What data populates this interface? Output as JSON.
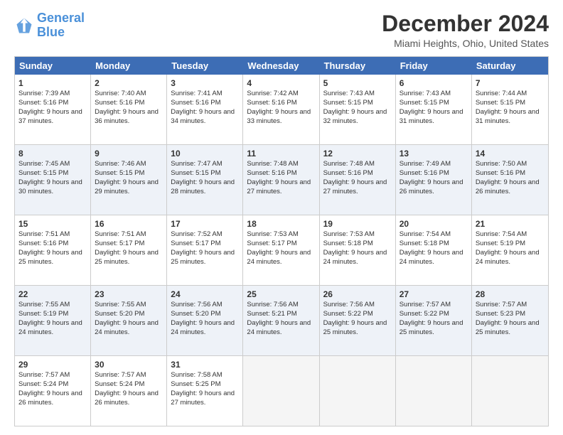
{
  "logo": {
    "line1": "General",
    "line2": "Blue"
  },
  "title": "December 2024",
  "subtitle": "Miami Heights, Ohio, United States",
  "days": [
    "Sunday",
    "Monday",
    "Tuesday",
    "Wednesday",
    "Thursday",
    "Friday",
    "Saturday"
  ],
  "weeks": [
    [
      {
        "day": "1",
        "sunrise": "Sunrise: 7:39 AM",
        "sunset": "Sunset: 5:16 PM",
        "daylight": "Daylight: 9 hours and 37 minutes."
      },
      {
        "day": "2",
        "sunrise": "Sunrise: 7:40 AM",
        "sunset": "Sunset: 5:16 PM",
        "daylight": "Daylight: 9 hours and 36 minutes."
      },
      {
        "day": "3",
        "sunrise": "Sunrise: 7:41 AM",
        "sunset": "Sunset: 5:16 PM",
        "daylight": "Daylight: 9 hours and 34 minutes."
      },
      {
        "day": "4",
        "sunrise": "Sunrise: 7:42 AM",
        "sunset": "Sunset: 5:16 PM",
        "daylight": "Daylight: 9 hours and 33 minutes."
      },
      {
        "day": "5",
        "sunrise": "Sunrise: 7:43 AM",
        "sunset": "Sunset: 5:15 PM",
        "daylight": "Daylight: 9 hours and 32 minutes."
      },
      {
        "day": "6",
        "sunrise": "Sunrise: 7:43 AM",
        "sunset": "Sunset: 5:15 PM",
        "daylight": "Daylight: 9 hours and 31 minutes."
      },
      {
        "day": "7",
        "sunrise": "Sunrise: 7:44 AM",
        "sunset": "Sunset: 5:15 PM",
        "daylight": "Daylight: 9 hours and 31 minutes."
      }
    ],
    [
      {
        "day": "8",
        "sunrise": "Sunrise: 7:45 AM",
        "sunset": "Sunset: 5:15 PM",
        "daylight": "Daylight: 9 hours and 30 minutes."
      },
      {
        "day": "9",
        "sunrise": "Sunrise: 7:46 AM",
        "sunset": "Sunset: 5:15 PM",
        "daylight": "Daylight: 9 hours and 29 minutes."
      },
      {
        "day": "10",
        "sunrise": "Sunrise: 7:47 AM",
        "sunset": "Sunset: 5:15 PM",
        "daylight": "Daylight: 9 hours and 28 minutes."
      },
      {
        "day": "11",
        "sunrise": "Sunrise: 7:48 AM",
        "sunset": "Sunset: 5:16 PM",
        "daylight": "Daylight: 9 hours and 27 minutes."
      },
      {
        "day": "12",
        "sunrise": "Sunrise: 7:48 AM",
        "sunset": "Sunset: 5:16 PM",
        "daylight": "Daylight: 9 hours and 27 minutes."
      },
      {
        "day": "13",
        "sunrise": "Sunrise: 7:49 AM",
        "sunset": "Sunset: 5:16 PM",
        "daylight": "Daylight: 9 hours and 26 minutes."
      },
      {
        "day": "14",
        "sunrise": "Sunrise: 7:50 AM",
        "sunset": "Sunset: 5:16 PM",
        "daylight": "Daylight: 9 hours and 26 minutes."
      }
    ],
    [
      {
        "day": "15",
        "sunrise": "Sunrise: 7:51 AM",
        "sunset": "Sunset: 5:16 PM",
        "daylight": "Daylight: 9 hours and 25 minutes."
      },
      {
        "day": "16",
        "sunrise": "Sunrise: 7:51 AM",
        "sunset": "Sunset: 5:17 PM",
        "daylight": "Daylight: 9 hours and 25 minutes."
      },
      {
        "day": "17",
        "sunrise": "Sunrise: 7:52 AM",
        "sunset": "Sunset: 5:17 PM",
        "daylight": "Daylight: 9 hours and 25 minutes."
      },
      {
        "day": "18",
        "sunrise": "Sunrise: 7:53 AM",
        "sunset": "Sunset: 5:17 PM",
        "daylight": "Daylight: 9 hours and 24 minutes."
      },
      {
        "day": "19",
        "sunrise": "Sunrise: 7:53 AM",
        "sunset": "Sunset: 5:18 PM",
        "daylight": "Daylight: 9 hours and 24 minutes."
      },
      {
        "day": "20",
        "sunrise": "Sunrise: 7:54 AM",
        "sunset": "Sunset: 5:18 PM",
        "daylight": "Daylight: 9 hours and 24 minutes."
      },
      {
        "day": "21",
        "sunrise": "Sunrise: 7:54 AM",
        "sunset": "Sunset: 5:19 PM",
        "daylight": "Daylight: 9 hours and 24 minutes."
      }
    ],
    [
      {
        "day": "22",
        "sunrise": "Sunrise: 7:55 AM",
        "sunset": "Sunset: 5:19 PM",
        "daylight": "Daylight: 9 hours and 24 minutes."
      },
      {
        "day": "23",
        "sunrise": "Sunrise: 7:55 AM",
        "sunset": "Sunset: 5:20 PM",
        "daylight": "Daylight: 9 hours and 24 minutes."
      },
      {
        "day": "24",
        "sunrise": "Sunrise: 7:56 AM",
        "sunset": "Sunset: 5:20 PM",
        "daylight": "Daylight: 9 hours and 24 minutes."
      },
      {
        "day": "25",
        "sunrise": "Sunrise: 7:56 AM",
        "sunset": "Sunset: 5:21 PM",
        "daylight": "Daylight: 9 hours and 24 minutes."
      },
      {
        "day": "26",
        "sunrise": "Sunrise: 7:56 AM",
        "sunset": "Sunset: 5:22 PM",
        "daylight": "Daylight: 9 hours and 25 minutes."
      },
      {
        "day": "27",
        "sunrise": "Sunrise: 7:57 AM",
        "sunset": "Sunset: 5:22 PM",
        "daylight": "Daylight: 9 hours and 25 minutes."
      },
      {
        "day": "28",
        "sunrise": "Sunrise: 7:57 AM",
        "sunset": "Sunset: 5:23 PM",
        "daylight": "Daylight: 9 hours and 25 minutes."
      }
    ],
    [
      {
        "day": "29",
        "sunrise": "Sunrise: 7:57 AM",
        "sunset": "Sunset: 5:24 PM",
        "daylight": "Daylight: 9 hours and 26 minutes."
      },
      {
        "day": "30",
        "sunrise": "Sunrise: 7:57 AM",
        "sunset": "Sunset: 5:24 PM",
        "daylight": "Daylight: 9 hours and 26 minutes."
      },
      {
        "day": "31",
        "sunrise": "Sunrise: 7:58 AM",
        "sunset": "Sunset: 5:25 PM",
        "daylight": "Daylight: 9 hours and 27 minutes."
      },
      null,
      null,
      null,
      null
    ]
  ]
}
